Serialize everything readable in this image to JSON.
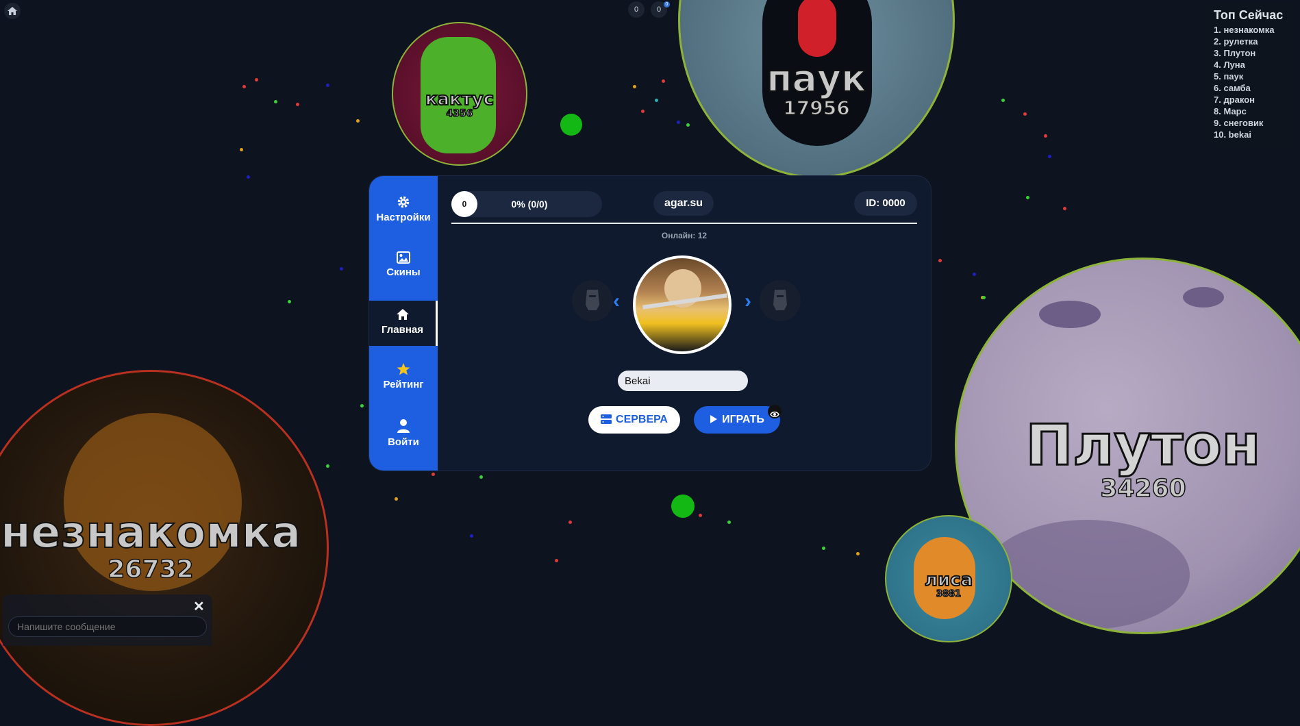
{
  "header": {
    "home_icon": "home-icon",
    "stats": [
      "0",
      "0"
    ],
    "stat_badge": "0"
  },
  "leaderboard": {
    "title": "Топ Сейчас",
    "rows": [
      "1. незнакомка",
      "2. рулетка",
      "3. Плутон",
      "4. Луна",
      "5. паук",
      "6. самба",
      "7. дракон",
      "8. Марс",
      "9. снеговик",
      "10. bekai"
    ]
  },
  "cells": {
    "cactus": {
      "name": "кактус",
      "mass": "4356"
    },
    "spider": {
      "name": "паук",
      "mass": "17956"
    },
    "pluto": {
      "name": "Плутон",
      "mass": "34260"
    },
    "stranger": {
      "name": "незнакомка",
      "mass": "26732"
    },
    "fox": {
      "name": "лиса",
      "mass": "3881"
    }
  },
  "menu": {
    "sidebar": [
      {
        "label": "Настройки",
        "icon": "gear-icon"
      },
      {
        "label": "Скины",
        "icon": "image-icon"
      },
      {
        "label": "Главная",
        "icon": "home-icon"
      },
      {
        "label": "Рейтинг",
        "icon": "star-icon"
      },
      {
        "label": "Войти",
        "icon": "user-icon"
      }
    ],
    "active_item": "Главная",
    "level": "0",
    "progress": "0% (0/0)",
    "site": "agar.su",
    "player_id": "ID: 0000",
    "online": "Онлайн: 12",
    "nickname": "Bekai",
    "servers_label": "СЕРВЕРА",
    "play_label": "ИГРАТЬ",
    "prev_arrow": "‹",
    "next_arrow": "›"
  },
  "chat": {
    "placeholder": "Напишите сообщение",
    "close": "✕"
  },
  "colors": {
    "accent": "#1d5fe0",
    "panel": "#0f1a2e",
    "background": "#0d1420",
    "cell_border": "#8db33a"
  }
}
